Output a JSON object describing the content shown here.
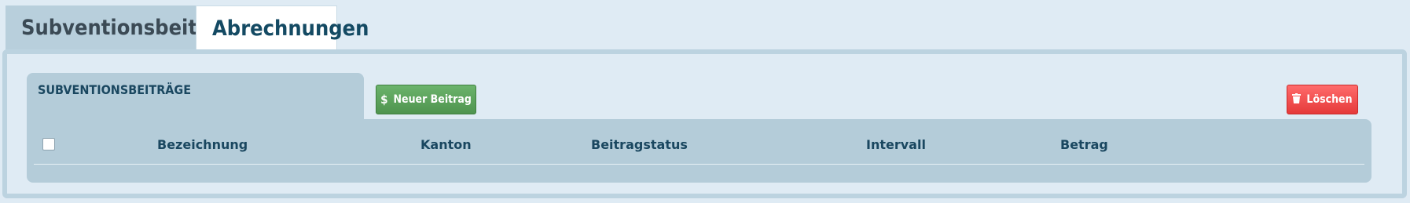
{
  "tabs": [
    {
      "label": "Subventionsbeiträge",
      "active": false
    },
    {
      "label": "Abrechnungen",
      "active": true
    }
  ],
  "section": {
    "title": "SUBVENTIONSBEITRÄGE"
  },
  "toolbar": {
    "new_label": "Neuer Beitrag",
    "new_icon": "dollar-icon",
    "delete_label": "Löschen",
    "delete_icon": "trash-icon"
  },
  "table": {
    "columns": [
      "Bezeichnung",
      "Kanton",
      "Beitragstatus",
      "Intervall",
      "Betrag"
    ],
    "rows": []
  },
  "colors": {
    "background": "#dfebf4",
    "panel": "#b4ccd9",
    "accent_text": "#1a4760",
    "button_green": "#5ea35e",
    "button_red": "#f24b4b"
  }
}
